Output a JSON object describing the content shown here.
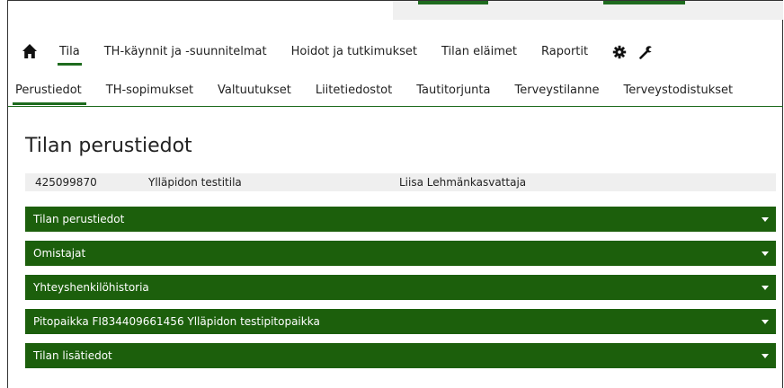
{
  "main_nav": {
    "items": [
      {
        "label": "Tila",
        "active": true
      },
      {
        "label": "TH-käynnit ja -suunnitelmat"
      },
      {
        "label": "Hoidot ja tutkimukset"
      },
      {
        "label": "Tilan eläimet"
      },
      {
        "label": "Raportit"
      }
    ],
    "icons": [
      "home-icon",
      "gear-icon",
      "wrench-icon"
    ]
  },
  "sub_nav": {
    "items": [
      {
        "label": "Perustiedot",
        "active": true
      },
      {
        "label": "TH-sopimukset"
      },
      {
        "label": "Valtuutukset"
      },
      {
        "label": "Liitetiedostot"
      },
      {
        "label": "Tautitorjunta"
      },
      {
        "label": "Terveystilanne"
      },
      {
        "label": "Terveystodistukset"
      }
    ]
  },
  "page": {
    "title": "Tilan perustiedot",
    "info": {
      "id": "425099870",
      "name": "Ylläpidon testitila",
      "owner": "Liisa Lehmänkasvattaja"
    },
    "panels": [
      {
        "label": "Tilan perustiedot"
      },
      {
        "label": "Omistajat"
      },
      {
        "label": "Yhteyshenkilöhistoria"
      },
      {
        "label": "Pitopaikka FI834409661456 Ylläpidon testipitopaikka"
      },
      {
        "label": "Tilan lisätiedot"
      }
    ]
  },
  "colors": {
    "accent": "#1e6b1e",
    "panel_bg": "#1c5f0c",
    "info_bg": "#efefef"
  }
}
